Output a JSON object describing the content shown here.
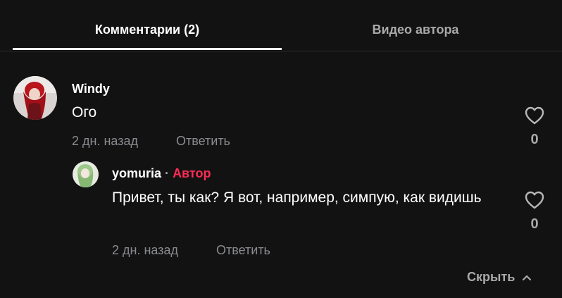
{
  "tabs": {
    "comments_label": "Комментарии (2)",
    "author_videos_label": "Видео автора"
  },
  "comment": {
    "username": "Windy",
    "text": "Ого",
    "time": "2 дн. назад",
    "reply_label": "Ответить",
    "likes": "0"
  },
  "reply": {
    "username": "yomuria",
    "separator": "·",
    "author_badge": "Автор",
    "text": "Привет, ты как? Я вот, например, симпую, как видишь",
    "time": "2 дн. назад",
    "reply_label": "Ответить",
    "likes": "0"
  },
  "actions": {
    "hide_label": "Скрыть"
  },
  "colors": {
    "background": "#121212",
    "accent": "#fe2c55",
    "muted": "#8a8b91"
  },
  "icons": [
    "heart-outline-icon",
    "chevron-up-icon"
  ]
}
